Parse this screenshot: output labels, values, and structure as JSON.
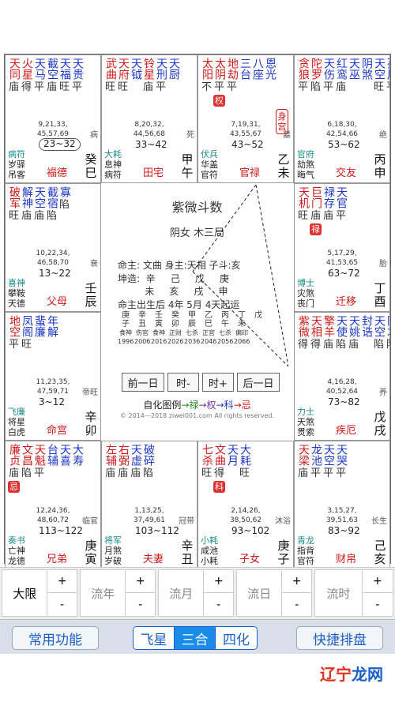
{
  "palaces": [
    {
      "id": "si",
      "stars": [
        {
          "n": "天同",
          "b": "庙",
          "c": "cr"
        },
        {
          "n": "火星",
          "b": "得",
          "c": "cr"
        },
        {
          "n": "天马",
          "b": "平",
          "c": "cb"
        },
        {
          "n": "截空",
          "b": "庙",
          "c": "cb"
        },
        {
          "n": "天福",
          "b": "旺",
          "c": "cb"
        },
        {
          "n": "天贵",
          "b": "平",
          "c": "cb"
        }
      ],
      "ages": "9,21,33,\n45,57,69",
      "chang": "病",
      "bottom": [
        "病符",
        "岁驿",
        "吊客"
      ],
      "range": "23~32",
      "boxed": true,
      "name": "福德",
      "stem": "癸巳"
    },
    {
      "id": "wu",
      "stars": [
        {
          "n": "武曲",
          "b": "旺",
          "c": "cr"
        },
        {
          "n": "天府",
          "b": "旺",
          "c": "cr"
        },
        {
          "n": "天钺",
          "b": "",
          "c": "cb"
        },
        {
          "n": "铃星",
          "b": "庙",
          "c": "cr"
        },
        {
          "n": "天刑",
          "b": "平",
          "c": "cb"
        },
        {
          "n": "天厨",
          "b": "",
          "c": "cb"
        }
      ],
      "ages": "8,20,32,\n44,56,68",
      "chang": "死",
      "bottom": [
        "大耗",
        "息神",
        "病符"
      ],
      "range": "33~42",
      "name": "田宅",
      "stem": "甲午"
    },
    {
      "id": "wei",
      "stars": [
        {
          "n": "太阳",
          "b": "不",
          "c": "cr"
        },
        {
          "n": "太阴",
          "b": "平",
          "c": "cr",
          "h": "权"
        },
        {
          "n": "地劫",
          "b": "平",
          "c": "cr"
        },
        {
          "n": "三台",
          "b": "",
          "c": "cb"
        },
        {
          "n": "八座",
          "b": "",
          "c": "cb"
        },
        {
          "n": "恩光",
          "b": "",
          "c": "cb"
        }
      ],
      "ages": "7,19,31,\n43,55,67",
      "chang": "墓",
      "bottom": [
        "伏兵",
        "华盖",
        "官符"
      ],
      "range": "43~52",
      "name": "官禄",
      "stem": "乙未",
      "shen": "身宫"
    },
    {
      "id": "shen",
      "stars": [
        {
          "n": "贪狼",
          "b": "平",
          "c": "cr"
        },
        {
          "n": "陀罗",
          "b": "陷",
          "c": "cr"
        },
        {
          "n": "天伤",
          "b": "平",
          "c": "cb"
        },
        {
          "n": "红鸾",
          "b": "庙",
          "c": "cb"
        },
        {
          "n": "天巫",
          "b": "",
          "c": "cb"
        },
        {
          "n": "阴煞",
          "b": "",
          "c": "cb"
        },
        {
          "n": "天空",
          "b": "旺",
          "c": "cb"
        },
        {
          "n": "孤辰",
          "b": "平",
          "c": "cb"
        }
      ],
      "ages": "6,18,30,\n42,54,66",
      "chang": "绝",
      "bottom": [
        "官府",
        "劫煞",
        "晦气"
      ],
      "range": "53~62",
      "name": "交友",
      "stem": "丙申"
    },
    {
      "id": "chen",
      "stars": [
        {
          "n": "破军",
          "b": "旺",
          "c": "cr"
        },
        {
          "n": "解神",
          "b": "庙",
          "c": "cb"
        },
        {
          "n": "天空",
          "b": "庙",
          "c": "cb"
        },
        {
          "n": "截宿",
          "b": "陷",
          "c": "cb"
        },
        {
          "n": "寡",
          "b": "陷",
          "c": "cb"
        }
      ],
      "ages": "10,22,34,\n46,58,70",
      "chang": "衰",
      "bottom": [
        "喜神",
        "攀鞍",
        "天德"
      ],
      "range": "13~22",
      "name": "父母",
      "stem": "壬辰"
    },
    {
      "id": "you",
      "stars": [
        {
          "n": "天机",
          "b": "旺",
          "c": "cr"
        },
        {
          "n": "巨门",
          "b": "庙",
          "c": "cr",
          "h": "禄"
        },
        {
          "n": "禄存",
          "b": "庙",
          "c": "cb"
        },
        {
          "n": "天官",
          "b": "平",
          "c": "cb"
        }
      ],
      "ages": "5,17,29,\n41,53,65",
      "chang": "胎",
      "bottom": [
        "博士",
        "灾煞",
        "丧门"
      ],
      "range": "63~72",
      "name": "迁移",
      "stem": "丁酉"
    },
    {
      "id": "mao",
      "stars": [
        {
          "n": "地空",
          "b": "平",
          "c": "cr"
        },
        {
          "n": "凤阁",
          "b": "旺",
          "c": "cb"
        },
        {
          "n": "蜚廉",
          "b": "",
          "c": "cb"
        },
        {
          "n": "年解",
          "b": "",
          "c": "cb"
        }
      ],
      "ages": "11,23,35,\n47,59,71",
      "chang": "帝旺",
      "bottom": [
        "飞廉",
        "将星",
        "白虎"
      ],
      "range": "3~12",
      "name": "命宫",
      "stem": "辛卯"
    },
    {
      "id": "xu",
      "stars": [
        {
          "n": "紫微",
          "b": "得",
          "c": "cr"
        },
        {
          "n": "天相",
          "b": "得",
          "c": "cr"
        },
        {
          "n": "擎羊",
          "b": "庙",
          "c": "cr"
        },
        {
          "n": "天使",
          "b": "陷",
          "c": "cb"
        },
        {
          "n": "天姚",
          "b": "庙",
          "c": "cb"
        },
        {
          "n": "封诰",
          "b": "",
          "c": "cb"
        },
        {
          "n": "天空",
          "b": "陷",
          "c": "cb"
        },
        {
          "n": "阴才",
          "b": "陷",
          "c": "cb"
        }
      ],
      "ages": "4,16,28,\n40,52,64",
      "chang": "养",
      "bottom": [
        "力士",
        "天煞",
        "贯索"
      ],
      "range": "73~82",
      "name": "疾厄",
      "stem": "戊戌"
    },
    {
      "id": "yin",
      "stars": [
        {
          "n": "廉贞",
          "b": "庙",
          "c": "cr",
          "h": "忌"
        },
        {
          "n": "文昌",
          "b": "陷",
          "c": "cr"
        },
        {
          "n": "天魁",
          "b": "平",
          "c": "cr"
        },
        {
          "n": "台辅",
          "b": "",
          "c": "cb"
        },
        {
          "n": "天喜",
          "b": "",
          "c": "cb"
        },
        {
          "n": "大寿",
          "b": "",
          "c": "cb"
        }
      ],
      "ages": "12,24,36,\n48,60,72",
      "chang": "临官",
      "bottom": [
        "奏书",
        "亡神",
        "龙德"
      ],
      "range": "113~122",
      "name": "兄弟",
      "stem": "庚寅"
    },
    {
      "id": "chou",
      "stars": [
        {
          "n": "左辅",
          "b": "庙",
          "c": "cr"
        },
        {
          "n": "右弼",
          "b": "庙",
          "c": "cr"
        },
        {
          "n": "天虚",
          "b": "庙",
          "c": "cb"
        },
        {
          "n": "破碎",
          "b": "陷",
          "c": "cb"
        }
      ],
      "ages": "1,13,25,\n37,49,61",
      "chang": "冠带",
      "bottom": [
        "将军",
        "月煞",
        "岁破"
      ],
      "range": "103~112",
      "name": "夫妻",
      "stem": "辛丑"
    },
    {
      "id": "zi",
      "stars": [
        {
          "n": "七杀",
          "b": "旺",
          "c": "cr"
        },
        {
          "n": "文曲",
          "b": "得",
          "c": "cr",
          "h": "科"
        },
        {
          "n": "天月",
          "b": "",
          "c": "cb"
        },
        {
          "n": "大耗",
          "b": "旺",
          "c": "cb"
        }
      ],
      "ages": "2,14,26,\n38,50,62",
      "chang": "沐浴",
      "bottom": [
        "小耗",
        "咸池",
        "小耗"
      ],
      "range": "93~102",
      "name": "子女",
      "stem": "庚子"
    },
    {
      "id": "hai",
      "stars": [
        {
          "n": "天梁",
          "b": "庙",
          "c": "cr"
        },
        {
          "n": "龙池",
          "b": "平",
          "c": "cb"
        },
        {
          "n": "天空",
          "b": "平",
          "c": "cb"
        },
        {
          "n": "天哭",
          "b": "平",
          "c": "cb"
        }
      ],
      "ages": "3,15,27,\n39,51,63",
      "chang": "长生",
      "bottom": [
        "青龙",
        "指背",
        "官符"
      ],
      "range": "83~92",
      "name": "财帛",
      "stem": "己亥"
    }
  ],
  "center": {
    "title": "紫微斗数",
    "sub": "阴女 木三局",
    "l1": "命主: 文曲 身主:天相 子斗:亥",
    "l2": "坤造:  辛     己     戊     庚",
    "l3": "         未     亥     戌     申",
    "l4": "命主出生后 4年 5月 4天起运",
    "dayun_stems": [
      "庚",
      "辛",
      "壬",
      "癸",
      "甲",
      "乙",
      "丙",
      "丁",
      "戊"
    ],
    "dayun_branches": [
      "子",
      "丑",
      "寅",
      "卯",
      "辰",
      "巳",
      "午",
      "未",
      ""
    ],
    "dayun_gods": [
      "食神",
      "伤官",
      "食神",
      "正财",
      "七杀",
      "正官",
      "七杀",
      "偏印",
      ""
    ],
    "dayun_years": [
      "1996",
      "2006",
      "2016",
      "2026",
      "2036",
      "2046",
      "2056",
      "2066",
      ""
    ],
    "btn_prev_day": "前一日",
    "btn_hour_minus": "时-",
    "btn_hour_plus": "时+",
    "btn_next_day": "后一日",
    "legend_prefix": "自化图例",
    "legend_lu": "→禄",
    "legend_quan": "→权",
    "legend_ke": "→科",
    "legend_ji": "→忌",
    "copyright": "© 2014—2018 ziwei001.com All rights reserved."
  },
  "controls": {
    "dayun": "大限",
    "liunian": "流年",
    "liuyue": "流月",
    "liuri": "流日",
    "liushi": "流时",
    "plus": "+",
    "minus": "-"
  },
  "toolbar": {
    "common": "常用功能",
    "feixing": "飞星",
    "sanhe": "三合",
    "sihua": "四化",
    "quick": "快捷排盘"
  },
  "watermark": {
    "a": "辽宁",
    "b": "龙网"
  },
  "colors": {
    "red": "#d01818",
    "blue": "#1a37c8",
    "seg_active": "#1a8be8"
  }
}
